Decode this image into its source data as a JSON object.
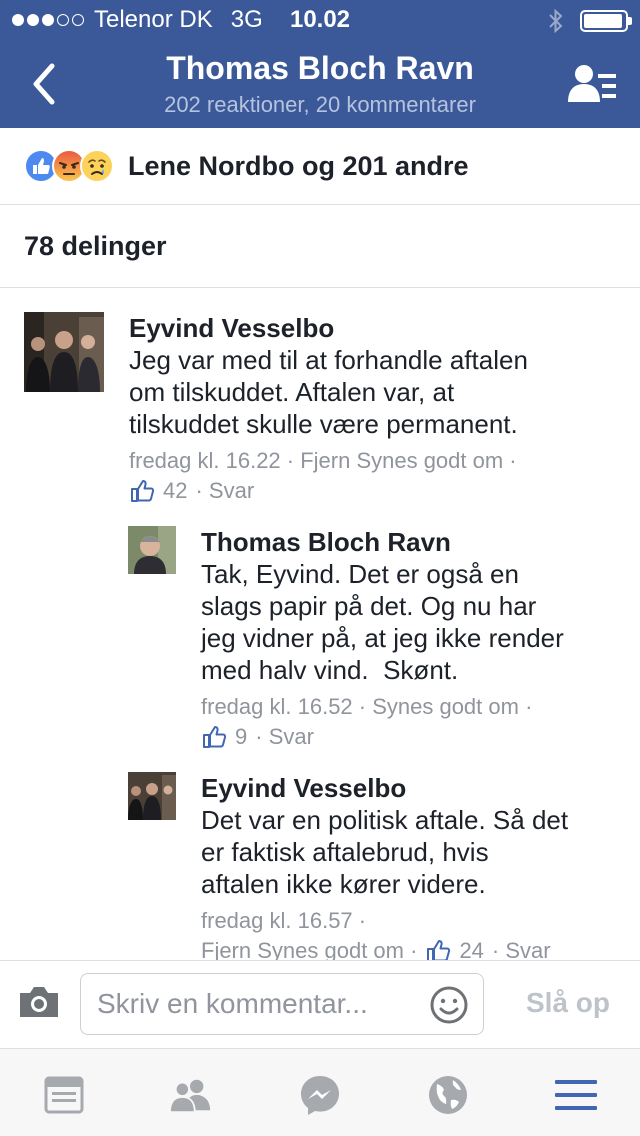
{
  "status_bar": {
    "carrier": "Telenor DK",
    "network": "3G",
    "time": "10.02",
    "signal_filled": 3,
    "signal_total": 5,
    "battery_level": 0.95
  },
  "header": {
    "title": "Thomas Bloch Ravn",
    "subtitle": "202 reaktioner, 20 kommentarer",
    "back_icon": "chevron-left-icon",
    "people_icon": "friend-list-icon"
  },
  "reactions": {
    "icons": [
      "like-icon",
      "angry-icon",
      "sad-icon"
    ],
    "label": "Lene Nordbo og 201 andre"
  },
  "shares": {
    "label": "78 delinger"
  },
  "comments": [
    {
      "author": "Eyvind Vesselbo",
      "text": "Jeg var med til at forhandle aftalen\nom tilskuddet. Aftalen var, at\ntilskuddet skulle være permanent.",
      "meta1": "fredag kl. 16.22 · Fjern Synes godt om ·",
      "likes": "42",
      "meta2": "· Svar"
    },
    {
      "author": "Thomas Bloch Ravn",
      "text": "Tak, Eyvind. Det er også en\nslags papir på det. Og nu har\njeg vidner på, at jeg ikke render\nmed halv vind.  Skønt.",
      "meta1": "fredag kl. 16.52 · Synes godt om ·",
      "likes": "9",
      "meta2": "· Svar"
    },
    {
      "author": "Eyvind Vesselbo",
      "text": "Det var en politisk aftale. Så det\ner faktisk aftalebrud, hvis\naftalen ikke kører videre.",
      "meta1": "fredag kl. 16.57 ·",
      "meta1b": "Fjern Synes godt om ·",
      "likes": "24",
      "meta2": "· Svar"
    }
  ],
  "composer": {
    "placeholder": "Skriv en kommentar...",
    "post_label": "Slå op"
  },
  "tabbar": {
    "tabs": [
      "news-feed-icon",
      "friends-icon",
      "messenger-icon",
      "globe-icon",
      "menu-icon"
    ],
    "active_index": 4
  },
  "colors": {
    "brand": "#3b5998",
    "subtitle": "#b5c3e0",
    "meta": "#90949c",
    "like_blue": "#4267b2"
  }
}
